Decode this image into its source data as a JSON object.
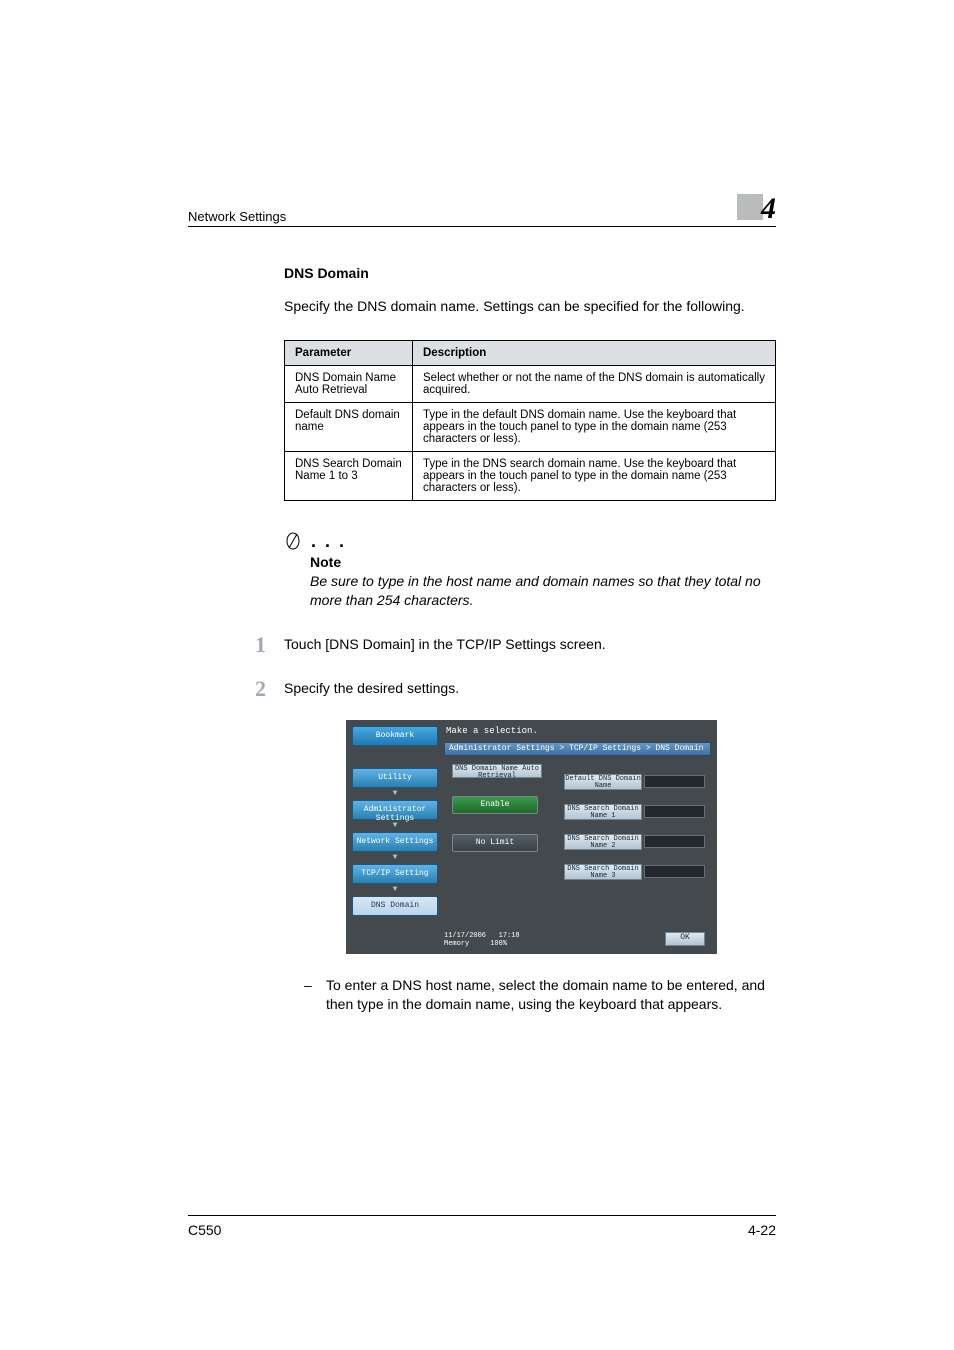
{
  "header": {
    "section": "Network Settings",
    "chapter": "4"
  },
  "subsection_title": "DNS Domain",
  "intro": "Specify the DNS domain name. Settings can be specified for the following.",
  "table": {
    "headers": [
      "Parameter",
      "Description"
    ],
    "rows": [
      {
        "param": "DNS Domain Name Auto Retrieval",
        "desc": "Select whether or not the name of the DNS domain is automatically acquired."
      },
      {
        "param": "Default DNS domain name",
        "desc": "Type in the default DNS domain name. Use the keyboard that appears in the touch panel to type in the domain name (253 characters or less)."
      },
      {
        "param": "DNS Search Domain Name 1 to 3",
        "desc": "Type in the DNS search domain name. Use the keyboard that appears in the touch panel to type in the domain name (253 characters or less)."
      }
    ]
  },
  "note": {
    "label": "Note",
    "body": "Be sure to type in the host name and domain names so that they total no more than 254 characters."
  },
  "steps": [
    {
      "num": "1",
      "text": "Touch [DNS Domain] in the TCP/IP Settings screen."
    },
    {
      "num": "2",
      "text": "Specify the desired settings."
    }
  ],
  "screenshot": {
    "top_prompt": "Make a selection.",
    "breadcrumb": "Administrator Settings > TCP/IP Settings > DNS Domain",
    "sidebar": {
      "bookmark": "Bookmark",
      "items": [
        "Utility",
        "Administrator Settings",
        "Network Settings",
        "TCP/IP Setting",
        "DNS Domain"
      ]
    },
    "top_label": "DNS Domain Name Auto Retrieval",
    "enable": "Enable",
    "nolimit": "No Limit",
    "default_dns": "Default DNS Domain Name",
    "search1": "DNS Search Domain Name 1",
    "search2": "DNS Search Domain Name 2",
    "search3": "DNS Search Domain Name 3",
    "ok": "OK",
    "status_date": "11/17/2006",
    "status_time": "17:18",
    "status_mem": "Memory",
    "status_pct": "100%"
  },
  "sub_item": "To enter a DNS host name, select the domain name to be entered, and then type in the domain name, using the keyboard that appears.",
  "footer": {
    "left": "C550",
    "right": "4-22"
  }
}
